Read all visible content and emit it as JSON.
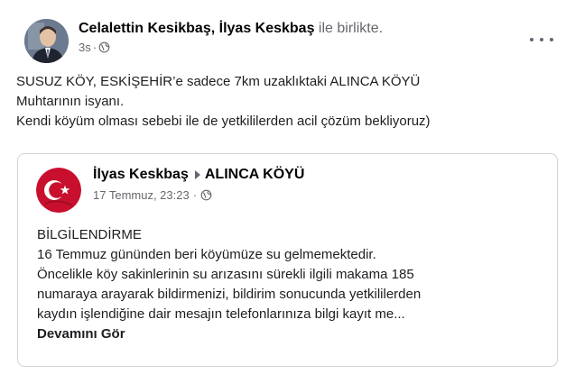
{
  "post": {
    "author": "Celalettin Kesikbaş",
    "separator": ", ",
    "tagged": "İlyas Keskbaş",
    "with_text": " ile birlikte.",
    "time": "3s",
    "privacy_icon": "globe-icon",
    "more_icon": "more-dots-icon",
    "text_lines": [
      "SUSUZ KÖY, ESKİŞEHİR’e sadece 7km uzaklıktaki ALINCA KÖYÜ",
      "Muhtarının isyanı.",
      "Kendi köyüm olması sebebi ile de yetkililerden acil çözüm bekliyoruz)"
    ]
  },
  "shared": {
    "author": "İlyas Keskbaş",
    "target": "ALINCA KÖYÜ",
    "date": "17 Temmuz, 23:23",
    "separator": " · ",
    "privacy_icon": "globe-icon",
    "text_lines": [
      "BİLGİLENDİRME",
      "16 Temmuz gününden beri köyümüze su gelmemektedir.",
      "Öncelikle köy sakinlerinin su arızasını sürekli ilgili makama 185",
      "numaraya arayarak bildirmenizi, bildirim sonucunda yetkililerden",
      "kaydın işlendiğine dair mesajın telefonlarınıza bilgi kayıt me..."
    ],
    "see_more": "Devamını Gör"
  },
  "colors": {
    "text": "#1c1e21",
    "secondary": "#65676b",
    "border": "#d0d3d8",
    "flag_red": "#c8102e"
  }
}
